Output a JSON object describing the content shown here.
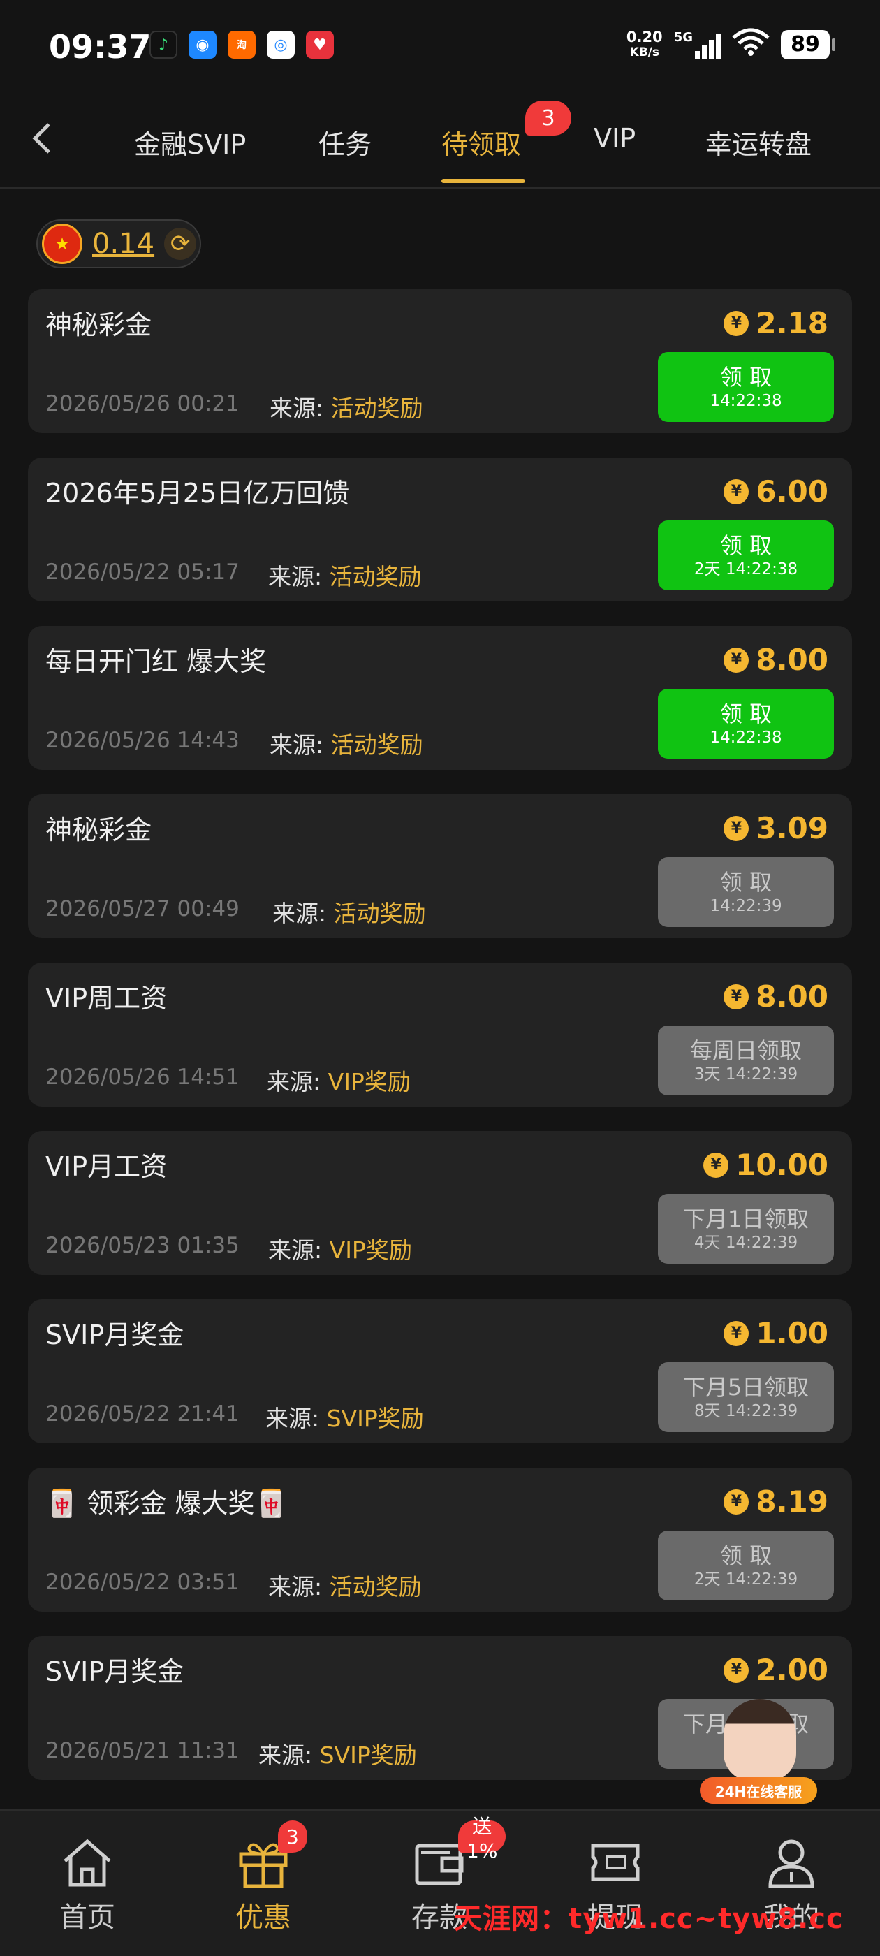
{
  "status_bar": {
    "time": "09:37",
    "net_speed_value": "0.20",
    "net_speed_unit": "KB/s",
    "network": "5G",
    "battery": "89",
    "app_icons": [
      "music-app-icon",
      "browser-app-icon",
      "taobao-app-icon",
      "photos-app-icon",
      "health-app-icon"
    ]
  },
  "tabs": {
    "items": [
      "金融SVIP",
      "任务",
      "待领取",
      "VIP",
      "幸运转盘"
    ],
    "active": "待领取",
    "badge": "3"
  },
  "balance": {
    "value": "0.14"
  },
  "cards": [
    {
      "title": "神秘彩金",
      "amount": "2.18",
      "date": "2026/05/26 00:21",
      "source_label": "来源:",
      "source": "活动奖励",
      "button": "领 取",
      "button_sub": "14:22:38",
      "button_state": "green"
    },
    {
      "title": "2026年5月25日亿万回馈",
      "amount": "6.00",
      "date": "2026/05/22 05:17",
      "source_label": "来源:",
      "source": "活动奖励",
      "button": "领 取",
      "button_sub": "2天 14:22:38",
      "button_state": "green"
    },
    {
      "title": "每日开门红 爆大奖",
      "amount": "8.00",
      "date": "2026/05/26 14:43",
      "source_label": "来源:",
      "source": "活动奖励",
      "button": "领 取",
      "button_sub": "14:22:38",
      "button_state": "green"
    },
    {
      "title": "神秘彩金",
      "amount": "3.09",
      "date": "2026/05/27 00:49",
      "source_label": "来源:",
      "source": "活动奖励",
      "button": "领 取",
      "button_sub": "14:22:39",
      "button_state": "gray"
    },
    {
      "title": "VIP周工资",
      "amount": "8.00",
      "date": "2026/05/26 14:51",
      "source_label": "来源:",
      "source": "VIP奖励",
      "button": "每周日领取",
      "button_sub": "3天 14:22:39",
      "button_state": "gray"
    },
    {
      "title": "VIP月工资",
      "amount": "10.00",
      "date": "2026/05/23 01:35",
      "source_label": "来源:",
      "source": "VIP奖励",
      "button": "下月1日领取",
      "button_sub": "4天 14:22:39",
      "button_state": "gray"
    },
    {
      "title": "SVIP月奖金",
      "amount": "1.00",
      "date": "2026/05/22 21:41",
      "source_label": "来源:",
      "source": "SVIP奖励",
      "button": "下月5日领取",
      "button_sub": "8天 14:22:39",
      "button_state": "gray"
    },
    {
      "title": "🀄 领彩金 爆大奖🀄",
      "amount": "8.19",
      "date": "2026/05/22 03:51",
      "source_label": "来源:",
      "source": "活动奖励",
      "button": "领 取",
      "button_sub": "2天 14:22:39",
      "button_state": "gray"
    },
    {
      "title": "SVIP月奖金",
      "amount": "2.00",
      "date": "2026/05/21 11:31",
      "source_label": "来源:",
      "source": "SVIP奖励",
      "button": "下月5日领取",
      "button_sub": "8天",
      "button_state": "gray"
    }
  ],
  "service": {
    "label": "24H在线客服"
  },
  "bottom_nav": {
    "items": [
      {
        "label": "首页",
        "icon": "home-icon"
      },
      {
        "label": "优惠",
        "icon": "gift-icon",
        "badge": "3"
      },
      {
        "label": "存款",
        "icon": "wallet-icon",
        "badge": "送1%"
      },
      {
        "label": "提现",
        "icon": "withdraw-icon"
      },
      {
        "label": "我的",
        "icon": "user-icon"
      }
    ],
    "active": "优惠"
  },
  "watermark": "天涯网：tyw1.cc~tyw8.cc",
  "colors": {
    "background": "#141414",
    "card": "#232323",
    "gold": "#e8b43c",
    "green_button": "#10c312",
    "gray_button": "#6a6a6a",
    "badge_red": "#f03a3a"
  }
}
